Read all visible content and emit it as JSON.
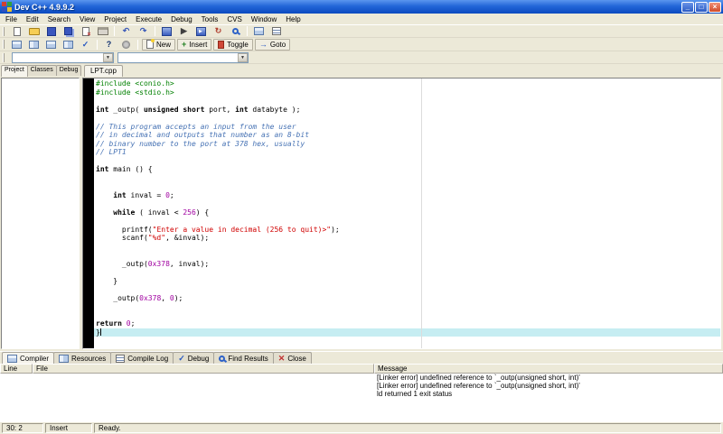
{
  "window": {
    "title": "Dev C++ 4.9.9.2",
    "minimize_glyph": "_",
    "maximize_glyph": "□",
    "close_glyph": "×"
  },
  "icons": {
    "dropdown_arrow": "▼"
  },
  "menu": {
    "items": [
      "File",
      "Edit",
      "Search",
      "View",
      "Project",
      "Execute",
      "Debug",
      "Tools",
      "CVS",
      "Window",
      "Help"
    ]
  },
  "toolbars": {
    "row1": [
      {
        "name": "new-source-file",
        "icon": "page"
      },
      {
        "name": "open-project",
        "icon": "folder"
      },
      {
        "name": "save",
        "icon": "floppy"
      },
      {
        "name": "save-all",
        "icon": "floppy2"
      },
      {
        "name": "close-file",
        "icon": "pagex"
      },
      {
        "name": "print",
        "icon": "printer"
      },
      {
        "sep": true
      },
      {
        "name": "undo",
        "icon": "glyph",
        "glyph": "↶",
        "color": "#3858B8"
      },
      {
        "name": "redo",
        "icon": "glyph",
        "glyph": "↷",
        "color": "#3858B8"
      },
      {
        "sep": true
      },
      {
        "name": "compile",
        "icon": "compile"
      },
      {
        "name": "run",
        "icon": "glyph",
        "glyph": "▶",
        "color": "#404040"
      },
      {
        "name": "compile-and-run",
        "icon": "comprun"
      },
      {
        "name": "rebuild-all",
        "icon": "glyph",
        "glyph": "↻",
        "color": "#B04030"
      },
      {
        "name": "debug",
        "icon": "magnifier"
      },
      {
        "sep": true
      },
      {
        "name": "profile",
        "icon": "grid"
      },
      {
        "name": "profiling-log",
        "icon": "loglist"
      }
    ],
    "row2": [
      {
        "name": "add-to-project",
        "icon": "grid"
      },
      {
        "name": "remove-from-project",
        "icon": "grid2"
      },
      {
        "name": "project-options",
        "icon": "grid"
      },
      {
        "name": "window-layout",
        "icon": "grid2"
      },
      {
        "name": "syntax-check",
        "icon": "glyph",
        "glyph": "✓",
        "color": "#2858C0"
      },
      {
        "sep": true
      },
      {
        "name": "help",
        "icon": "glyph",
        "glyph": "?",
        "color": "#103070"
      },
      {
        "name": "environment-options",
        "icon": "gear"
      },
      {
        "sep": true
      },
      {
        "name": "new",
        "icon": "pagenew",
        "label": "New"
      },
      {
        "name": "insert",
        "icon": "glyph",
        "glyph": "+",
        "color": "#208020",
        "label": "Insert"
      },
      {
        "name": "toggle",
        "icon": "bookmark",
        "label": "Toggle"
      },
      {
        "name": "goto",
        "icon": "glyph",
        "glyph": "→",
        "color": "#2858C0",
        "label": "Goto"
      }
    ]
  },
  "combos": [
    {
      "name": "compiler-combo",
      "value": ""
    },
    {
      "name": "class-browser-combo",
      "value": ""
    }
  ],
  "panels": {
    "left_tabs": [
      {
        "label": "Project",
        "active": true
      },
      {
        "label": "Classes",
        "active": false
      },
      {
        "label": "Debug",
        "active": false
      }
    ]
  },
  "editor": {
    "tabs": [
      {
        "label": "LPT.cpp",
        "active": true
      }
    ],
    "highlighted_line": 30,
    "lines": [
      [
        [
          "pp",
          "#include <conio.h>"
        ]
      ],
      [
        [
          "pp",
          "#include <stdio.h>"
        ]
      ],
      [],
      [
        [
          "kw",
          "int"
        ],
        [
          "pl",
          " _outp( "
        ],
        [
          "kw",
          "unsigned short"
        ],
        [
          "pl",
          " port, "
        ],
        [
          "kw",
          "int"
        ],
        [
          "pl",
          " databyte );"
        ]
      ],
      [],
      [
        [
          "com",
          "// This program accepts an input from the user"
        ]
      ],
      [
        [
          "com",
          "// in decimal and outputs that number as an 8-bit"
        ]
      ],
      [
        [
          "com",
          "// binary number to the port at 378 hex, usually"
        ]
      ],
      [
        [
          "com",
          "// LPT1"
        ]
      ],
      [],
      [
        [
          "kw",
          "int"
        ],
        [
          "pl",
          " main () {"
        ]
      ],
      [],
      [],
      [
        [
          "pl",
          "    "
        ],
        [
          "kw",
          "int"
        ],
        [
          "pl",
          " inval = "
        ],
        [
          "num",
          "0"
        ],
        [
          "pl",
          ";"
        ]
      ],
      [],
      [
        [
          "pl",
          "    "
        ],
        [
          "kw",
          "while"
        ],
        [
          "pl",
          " ( inval < "
        ],
        [
          "num",
          "256"
        ],
        [
          "pl",
          ") {"
        ]
      ],
      [],
      [
        [
          "pl",
          "      printf("
        ],
        [
          "str",
          "\"Enter a value in decimal (256 to quit)>\""
        ],
        [
          "pl",
          ");"
        ]
      ],
      [
        [
          "pl",
          "      scanf("
        ],
        [
          "str",
          "\"%d\""
        ],
        [
          "pl",
          ", &inval);"
        ]
      ],
      [],
      [],
      [
        [
          "pl",
          "      _outp("
        ],
        [
          "num",
          "0x378"
        ],
        [
          "pl",
          ", inval);"
        ]
      ],
      [],
      [
        [
          "pl",
          "    }"
        ]
      ],
      [],
      [
        [
          "pl",
          "    _outp("
        ],
        [
          "num",
          "0x378"
        ],
        [
          "pl",
          ", "
        ],
        [
          "num",
          "0"
        ],
        [
          "pl",
          ");"
        ]
      ],
      [],
      [],
      [
        [
          "kw",
          "return"
        ],
        [
          "pl",
          " "
        ],
        [
          "num",
          "0"
        ],
        [
          "pl",
          ";"
        ]
      ],
      [
        [
          "pl",
          "}"
        ]
      ]
    ]
  },
  "bottom_tabs": [
    {
      "label": "Compiler",
      "name": "tab-compiler",
      "icon": "grid",
      "active": true
    },
    {
      "label": "Resources",
      "name": "tab-resources",
      "icon": "grid2",
      "active": false
    },
    {
      "label": "Compile Log",
      "name": "tab-compile-log",
      "icon": "loglist",
      "active": false
    },
    {
      "label": "Debug",
      "name": "tab-debug",
      "icon": "glyph",
      "glyph": "✓",
      "color": "#2858C0",
      "active": false
    },
    {
      "label": "Find Results",
      "name": "tab-find-results",
      "icon": "magnifier",
      "active": false
    },
    {
      "label": "Close",
      "name": "tab-close",
      "icon": "glyph",
      "glyph": "✕",
      "color": "#C03030",
      "active": false
    }
  ],
  "results": {
    "columns": [
      "Line",
      "File",
      "Message"
    ],
    "rows": [
      {
        "line": "",
        "file": "",
        "message": "[Linker error] undefined reference to `_outp(unsigned short, int)'"
      },
      {
        "line": "",
        "file": "",
        "message": "[Linker error] undefined reference to `_outp(unsigned short, int)'"
      },
      {
        "line": "",
        "file": "",
        "message": "ld returned 1 exit status"
      }
    ]
  },
  "status_bar": {
    "position": "30: 2",
    "mode": "Insert",
    "message": "Ready."
  },
  "colors": {
    "titlebar_top": "#5A96EE",
    "titlebar_bottom": "#0B4ABF",
    "preprocessor": "#008000",
    "keyword": "#000000",
    "comment": "#4672B4",
    "string": "#D00000",
    "number": "#A000A0",
    "highlight_line": "#C6EDF2",
    "gutter": "#000000"
  }
}
